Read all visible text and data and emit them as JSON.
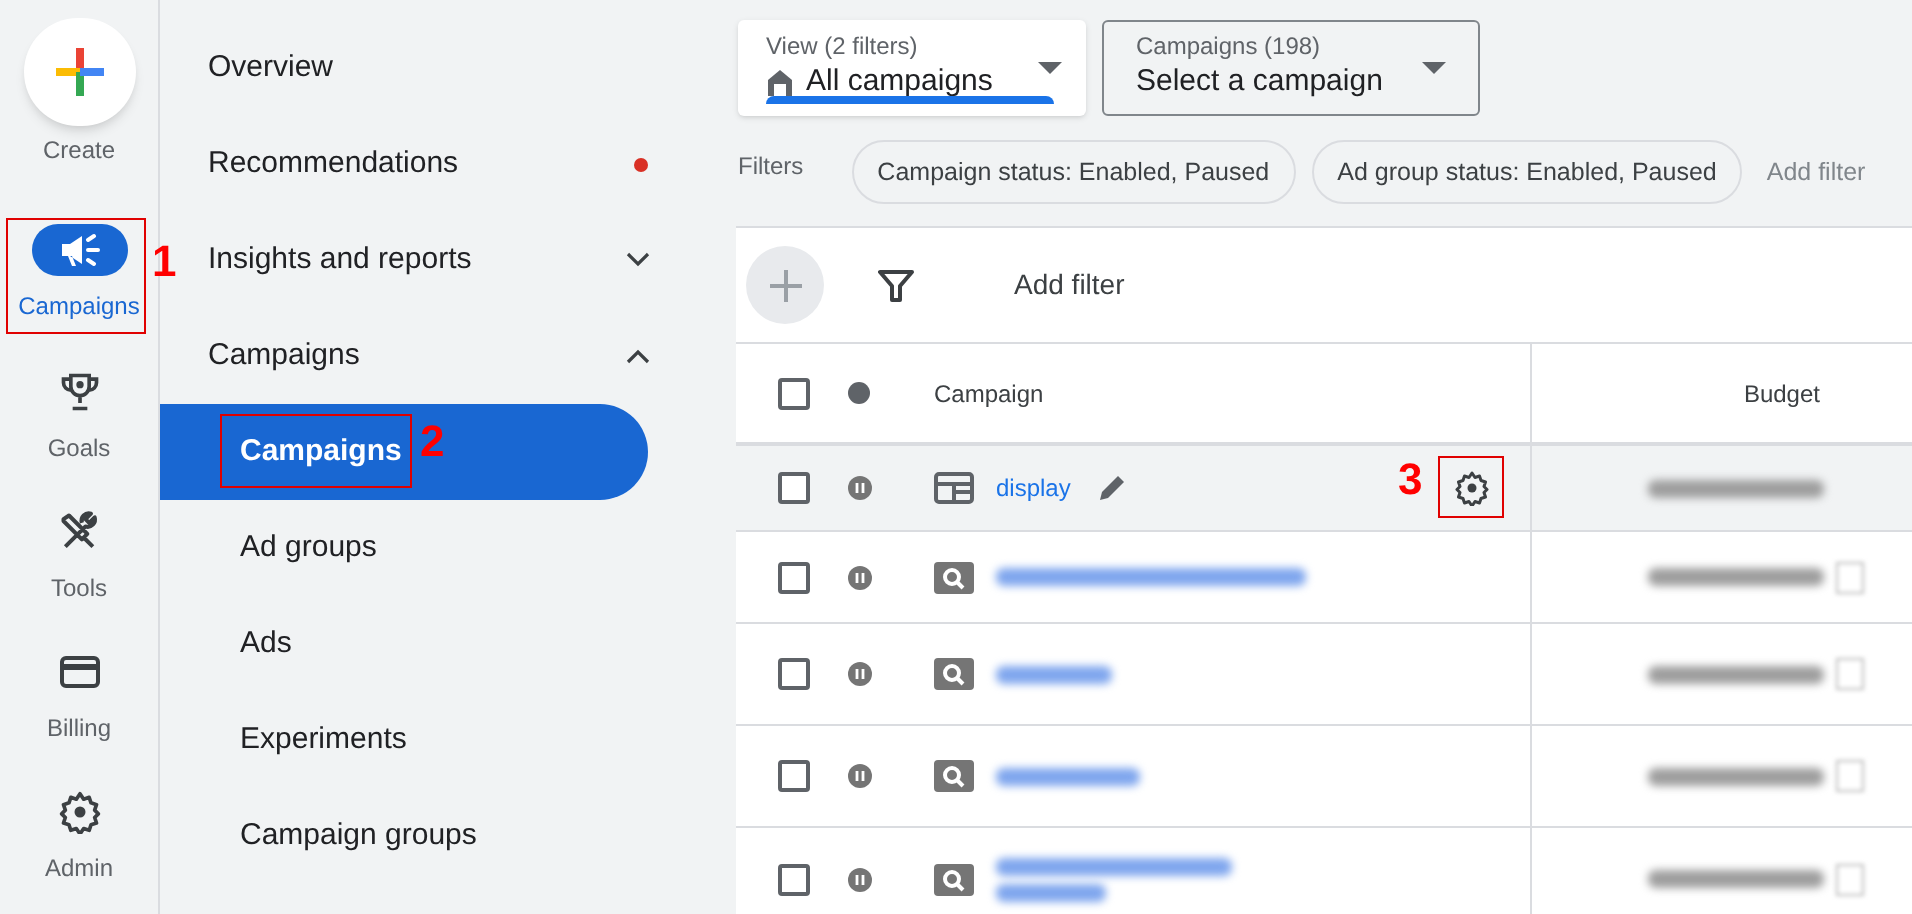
{
  "rail": {
    "create": {
      "label": "Create"
    },
    "items": [
      {
        "label": "Campaigns",
        "kind": "megaphone",
        "selected": true
      },
      {
        "label": "Goals",
        "kind": "trophy",
        "selected": false
      },
      {
        "label": "Tools",
        "kind": "tools",
        "selected": false
      },
      {
        "label": "Billing",
        "kind": "card",
        "selected": false
      },
      {
        "label": "Admin",
        "kind": "gear",
        "selected": false
      }
    ]
  },
  "nav": [
    {
      "label": "Overview",
      "selected": false
    },
    {
      "label": "Recommendations",
      "selected": false,
      "notification": true
    },
    {
      "label": "Insights and reports",
      "selected": false,
      "expanded": false
    },
    {
      "label": "Campaigns",
      "selected": false,
      "expanded": true,
      "children": [
        {
          "label": "Campaigns",
          "selected": true
        },
        {
          "label": "Ad groups",
          "selected": false
        },
        {
          "label": "Ads",
          "selected": false
        },
        {
          "label": "Experiments",
          "selected": false
        },
        {
          "label": "Campaign groups",
          "selected": false
        }
      ]
    }
  ],
  "view_dropdown": {
    "caption": "View (2 filters)",
    "value": "All campaigns"
  },
  "campaign_dropdown": {
    "caption": "Campaigns (198)",
    "value": "Select a campaign"
  },
  "filters": {
    "label": "Filters",
    "chips": [
      "Campaign status: Enabled, Paused",
      "Ad group status: Enabled, Paused"
    ],
    "add": "Add filter"
  },
  "toolbar": {
    "add_filter": "Add filter"
  },
  "table": {
    "columns": [
      "Campaign",
      "Budget"
    ],
    "all_checked": false,
    "rows": [
      {
        "kind": "display",
        "name": "display",
        "hovered": true,
        "checked": false
      },
      {
        "kind": "search",
        "redacted": true,
        "hovered": false,
        "checked": false
      },
      {
        "kind": "search",
        "redacted": true,
        "hovered": false,
        "checked": false
      },
      {
        "kind": "search",
        "redacted": true,
        "hovered": false,
        "checked": false
      },
      {
        "kind": "search",
        "redacted": true,
        "hovered": false,
        "checked": false
      }
    ]
  },
  "annotations": [
    {
      "label": "1"
    },
    {
      "label": "2"
    },
    {
      "label": "3"
    }
  ]
}
